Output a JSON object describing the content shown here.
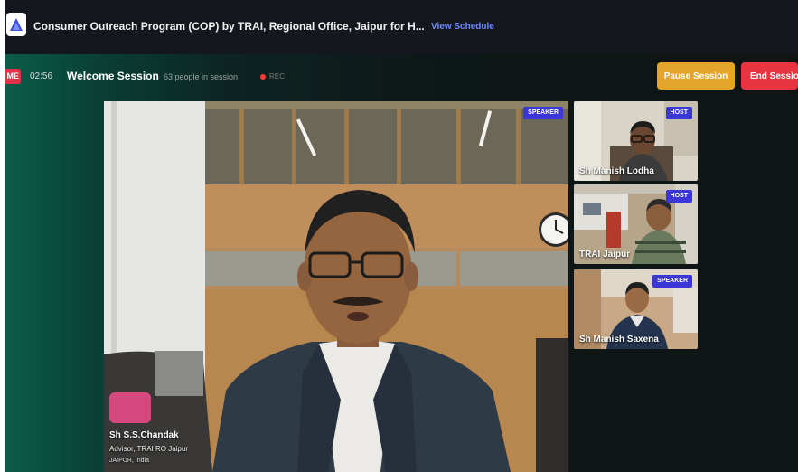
{
  "header": {
    "event_title": "Consumer Outreach Program (COP) by TRAI, Regional Office, Jaipur for H...",
    "view_schedule": "View Schedule"
  },
  "session": {
    "live_badge": "ME",
    "timer": "02:56",
    "name": "Welcome Session",
    "people": "63 people in session",
    "recording_label": "REC",
    "pause_label": "Pause Session",
    "end_label": "End Session"
  },
  "main_video": {
    "tag": "SPEAKER",
    "name": "Sh S.S.Chandak",
    "role": "Advisor, TRAI RO Jaipur",
    "location": "JAIPUR, India"
  },
  "participants": [
    {
      "tag": "HOST",
      "name": "Sh Manish Lodha"
    },
    {
      "tag": "HOST",
      "name": "TRAI Jaipur"
    },
    {
      "tag": "SPEAKER",
      "name": "Sh Manish Saxena"
    }
  ],
  "colors": {
    "accent_blue": "#3b36d6",
    "pause_button": "#e5a42a",
    "end_button": "#e8343f",
    "live_badge": "#e5304a",
    "link": "#6f8cff"
  }
}
